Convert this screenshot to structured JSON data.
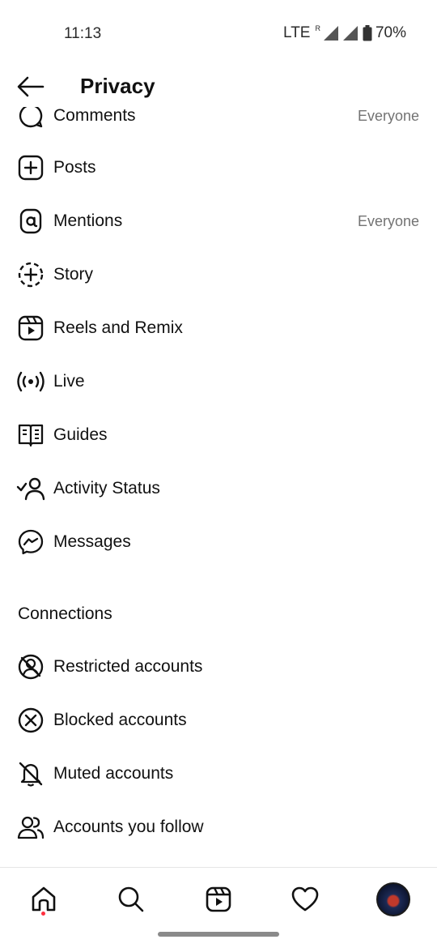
{
  "status_bar": {
    "time": "11:13",
    "network": "LTE",
    "roaming": "R",
    "battery": "70%"
  },
  "header": {
    "title": "Privacy"
  },
  "interactions": {
    "partial_item": {
      "label": "Comments",
      "value": "Everyone"
    },
    "items": [
      {
        "label": "Posts",
        "value": "",
        "icon": "plus-square-icon"
      },
      {
        "label": "Mentions",
        "value": "Everyone",
        "icon": "at-sign-icon"
      },
      {
        "label": "Story",
        "value": "",
        "icon": "story-add-icon"
      },
      {
        "label": "Reels and Remix",
        "value": "",
        "icon": "reels-icon"
      },
      {
        "label": "Live",
        "value": "",
        "icon": "live-broadcast-icon"
      },
      {
        "label": "Guides",
        "value": "",
        "icon": "guide-book-icon"
      },
      {
        "label": "Activity Status",
        "value": "",
        "icon": "activity-status-icon"
      },
      {
        "label": "Messages",
        "value": "",
        "icon": "messenger-icon"
      }
    ]
  },
  "connections": {
    "title": "Connections",
    "items": [
      {
        "label": "Restricted accounts",
        "icon": "restricted-icon"
      },
      {
        "label": "Blocked accounts",
        "icon": "blocked-icon"
      },
      {
        "label": "Muted accounts",
        "icon": "muted-bell-icon"
      },
      {
        "label": "Accounts you follow",
        "icon": "following-people-icon"
      }
    ]
  },
  "bottom_nav": {
    "items": [
      "home-icon",
      "search-icon",
      "reels-icon",
      "heart-icon",
      "profile-avatar"
    ],
    "active": "home-icon",
    "notification_dot_color": "#ff3040"
  }
}
